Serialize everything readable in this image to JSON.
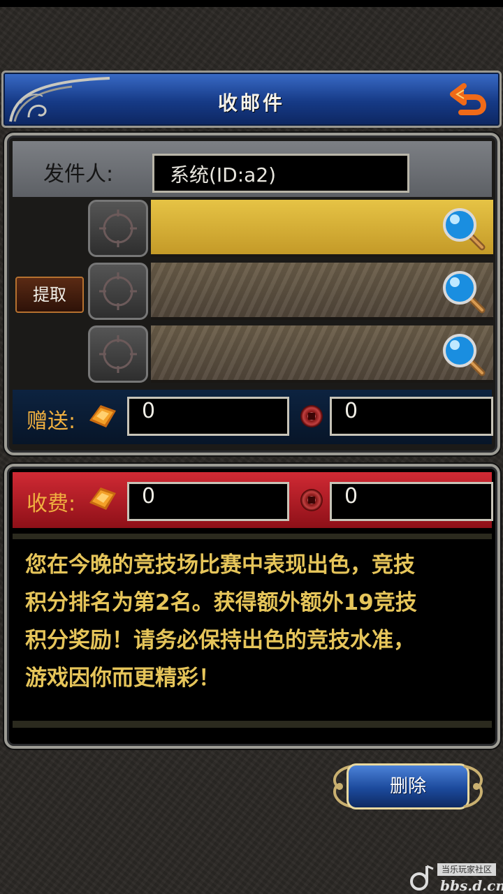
{
  "title": "收邮件",
  "sender": {
    "label": "发件人:",
    "value": "系统(ID:a2)"
  },
  "attachments": {
    "extract_label": "提取",
    "slots": [
      {
        "selected": true
      },
      {
        "selected": false
      },
      {
        "selected": false
      }
    ]
  },
  "gift": {
    "label": "赠送:",
    "gold": "0",
    "coins": "0"
  },
  "fee": {
    "label": "收费:",
    "gold": "0",
    "coins": "0"
  },
  "message": {
    "lines": [
      "您在今晚的竞技场比赛中表现出色，竞技",
      "积分排名为第2名。获得额外额外19竞技",
      "积分奖励！请务必保持出色的竞技水准，",
      "游戏因你而更精彩！"
    ]
  },
  "delete_label": "删除",
  "watermark": {
    "tag": "当乐玩家社区",
    "domain": "bbs.d.cn"
  },
  "colors": {
    "title_blue": "#163a86",
    "selected_slot": "#e6c345",
    "fee_red": "#d02a34",
    "message_text": "#e6c55a",
    "label_orange": "#f0b040"
  },
  "icons": {
    "back": "return-arrow-icon",
    "magnifier": "magnifier-icon",
    "gold": "gold-ingot-icon",
    "coin": "copper-coin-icon"
  }
}
